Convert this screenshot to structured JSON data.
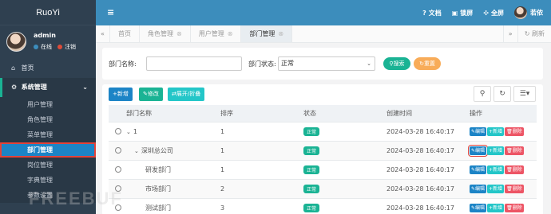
{
  "app": {
    "logo": "RuoYi"
  },
  "user": {
    "name": "admin",
    "status_online": "在线",
    "logout": "注销"
  },
  "sidebar": {
    "home": "首页",
    "system": "系统管理",
    "items": [
      {
        "label": "用户管理"
      },
      {
        "label": "角色管理"
      },
      {
        "label": "菜单管理"
      },
      {
        "label": "部门管理"
      },
      {
        "label": "岗位管理"
      },
      {
        "label": "字典管理"
      },
      {
        "label": "参数设置"
      }
    ]
  },
  "topbar": {
    "docs": "文档",
    "lock": "锁屏",
    "fullscreen": "全屏",
    "username": "若依"
  },
  "tabs": [
    {
      "label": "首页"
    },
    {
      "label": "角色管理"
    },
    {
      "label": "用户管理"
    },
    {
      "label": "部门管理"
    }
  ],
  "tab_refresh": "刷新",
  "search": {
    "dept_name_label": "部门名称:",
    "dept_name_value": "",
    "status_label": "部门状态:",
    "status_value": "正常",
    "search_btn": "搜索",
    "reset_btn": "重置"
  },
  "toolbar": {
    "add": "新增",
    "edit": "修改",
    "expand": "展开/折叠"
  },
  "table": {
    "headers": [
      "部门名称",
      "排序",
      "状态",
      "创建时间",
      "操作"
    ],
    "rows": [
      {
        "name": "1",
        "order": "1",
        "status": "正常",
        "created": "2024-03-28 16:40:17"
      },
      {
        "name": "深圳总公司",
        "order": "1",
        "status": "正常",
        "created": "2024-03-28 16:40:17"
      },
      {
        "name": "研发部门",
        "order": "1",
        "status": "正常",
        "created": "2024-03-28 16:40:17"
      },
      {
        "name": "市场部门",
        "order": "2",
        "status": "正常",
        "created": "2024-03-28 16:40:17"
      },
      {
        "name": "测试部门",
        "order": "3",
        "status": "正常",
        "created": "2024-03-28 16:40:17"
      }
    ],
    "op_edit": "编辑",
    "op_add": "新增",
    "op_del": "删除"
  },
  "colors": {
    "sidebar": "#2f4050",
    "topbar": "#3c8dbc",
    "primary": "#1c84c6",
    "success": "#1ab394",
    "info": "#23c6c8",
    "warning": "#f8ac59",
    "danger": "#ed5565",
    "highlight": "#e2433a"
  },
  "watermark": "FREEBUF"
}
